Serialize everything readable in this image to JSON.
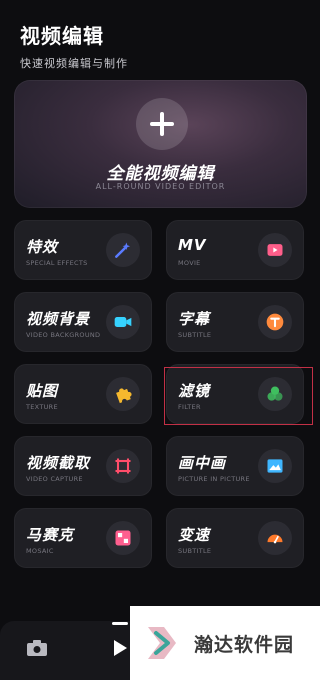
{
  "header": {
    "title": "视频编辑",
    "subtitle": "快速视频编辑与制作"
  },
  "hero": {
    "title": "全能视频编辑",
    "subtitle": "ALL-ROUND VIDEO EDITOR"
  },
  "tiles": [
    {
      "label": "特效",
      "sub": "SPECIAL EFFECTS",
      "icon": "magic-wand-icon",
      "color": "#5a7bff"
    },
    {
      "label": "MV",
      "sub": "MOVIE",
      "icon": "video-play-icon",
      "color": "#ff5e8a"
    },
    {
      "label": "视频背景",
      "sub": "VIDEO BACKGROUND",
      "icon": "camera-recorder-icon",
      "color": "#36d2ff"
    },
    {
      "label": "字幕",
      "sub": "SUBTITLE",
      "icon": "text-icon",
      "color": "#ff8a3d"
    },
    {
      "label": "贴图",
      "sub": "TEXTURE",
      "icon": "puzzle-icon",
      "color": "#f5b82e"
    },
    {
      "label": "滤镜",
      "sub": "FILTER",
      "icon": "filter-icon",
      "color": "#3fbf5f"
    },
    {
      "label": "视频截取",
      "sub": "VIDEO CAPTURE",
      "icon": "crop-icon",
      "color": "#ff4d6a"
    },
    {
      "label": "画中画",
      "sub": "PICTURE IN PICTURE",
      "icon": "image-icon",
      "color": "#3fb6ff"
    },
    {
      "label": "马赛克",
      "sub": "MOSAIC",
      "icon": "mosaic-icon",
      "color": "#ff5f8f"
    },
    {
      "label": "变速",
      "sub": "SUBTITLE",
      "icon": "speedometer-icon",
      "color": "#ff7a2b"
    }
  ],
  "watermark": {
    "text": "瀚达软件园"
  }
}
